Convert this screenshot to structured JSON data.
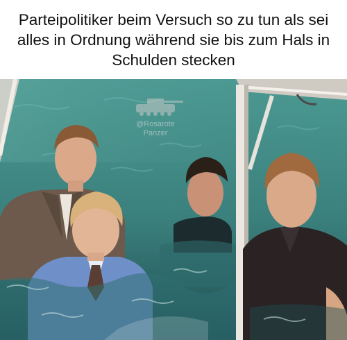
{
  "caption": {
    "text": "Parteipolitiker beim Versuch so zu tun als sei alles in Ordnung während sie bis zum Hals in Schulden stecken"
  },
  "watermark": {
    "line1": "@Rosarote",
    "line2": "Panzer",
    "icon": "tank-icon"
  },
  "photo": {
    "description_icon": "pool-photo",
    "colors": {
      "water": "#3f8a85",
      "water_dark": "#1f4f52",
      "suit_jacket": "#6e5a4c",
      "blue_shirt": "#6f8fc8",
      "dark_shirt": "#2a2223",
      "skin": "#d9a98a",
      "hair_blond": "#d8b27a",
      "hair_dark": "#2a2018",
      "hair_auburn": "#8a5a36",
      "boat_frame": "#e6e2da"
    }
  }
}
